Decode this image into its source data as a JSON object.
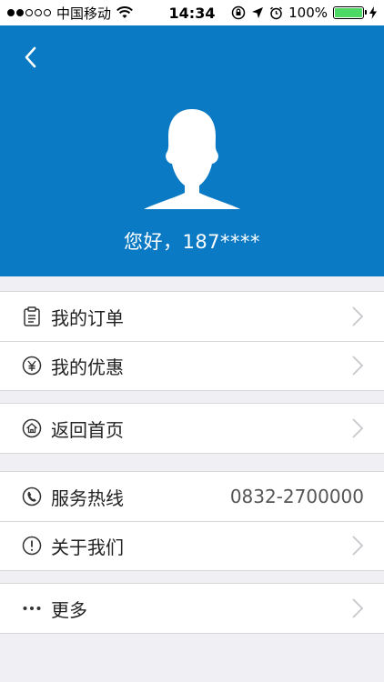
{
  "status_bar": {
    "carrier": "中国移动",
    "time": "14:34",
    "battery": "100%",
    "battery_level": 1.0
  },
  "header": {
    "greeting": "您好，187****",
    "background": "#0a7ac5"
  },
  "menu": {
    "group1": [
      {
        "label": "我的订单",
        "icon": "order-clipboard-icon"
      },
      {
        "label": "我的优惠",
        "icon": "yen-coupon-icon"
      }
    ],
    "group2": [
      {
        "label": "返回首页",
        "icon": "home-icon"
      }
    ],
    "group3": [
      {
        "label": "服务热线",
        "icon": "phone-icon",
        "value": "0832-2700000"
      },
      {
        "label": "关于我们",
        "icon": "info-icon"
      }
    ],
    "group4": [
      {
        "label": "更多",
        "icon": "more-dots-icon"
      }
    ]
  }
}
